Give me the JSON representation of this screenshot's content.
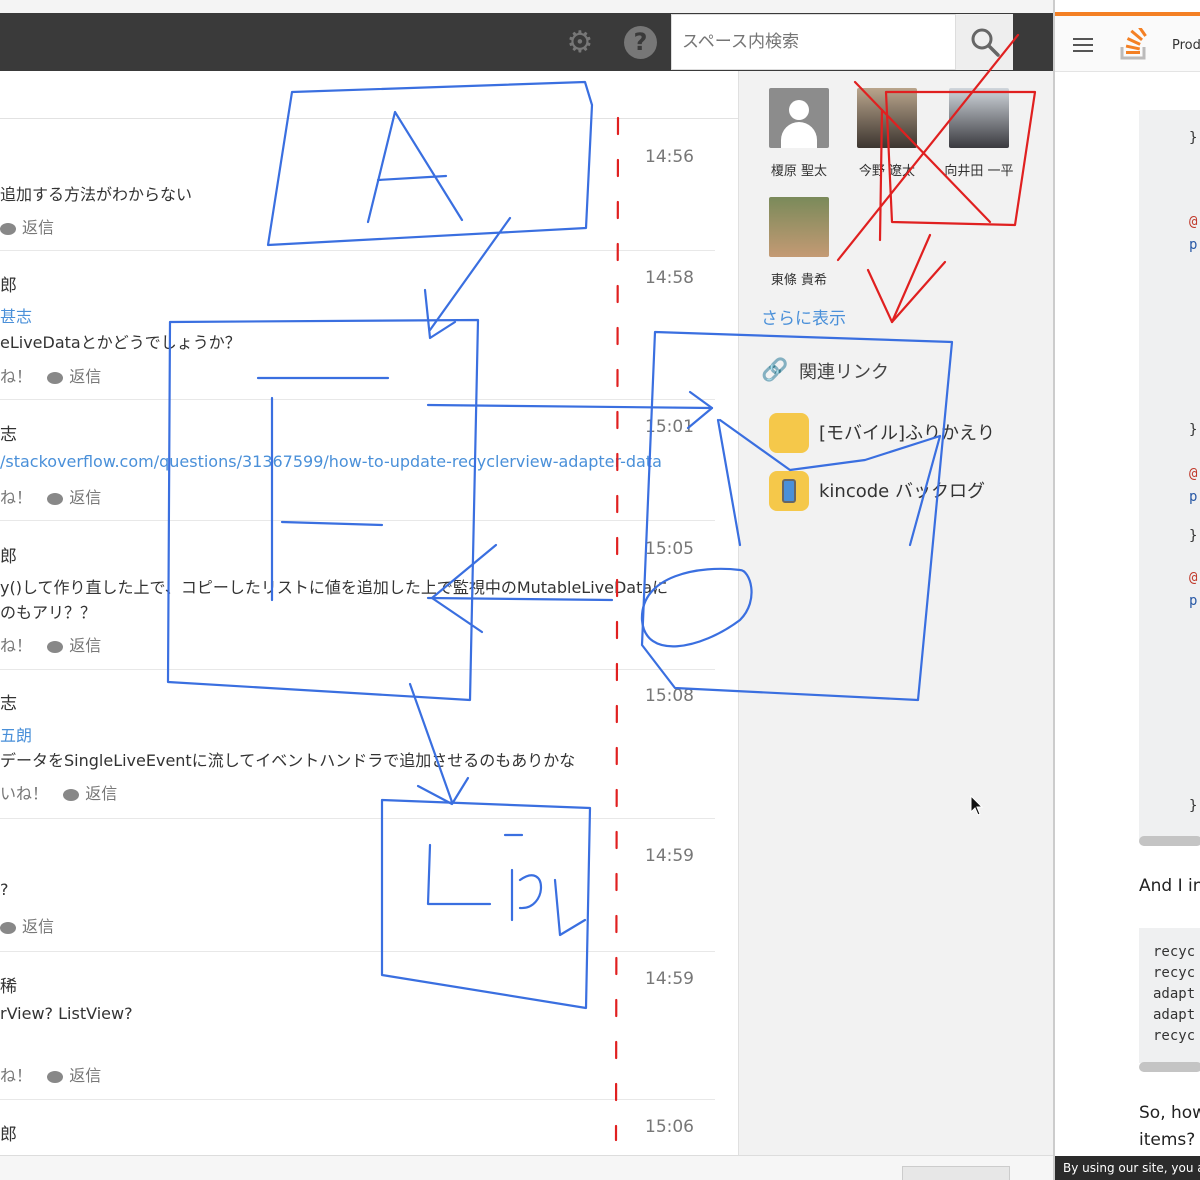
{
  "header": {
    "search_placeholder": "スペース内検索",
    "settings_icon": "gear-icon",
    "help_icon": "help-icon",
    "search_icon": "magnifier-icon"
  },
  "posts": [
    {
      "time": "14:56",
      "body": "追加する方法がわからない",
      "reply": "返信"
    },
    {
      "time": "14:58",
      "author": "郎",
      "mention": "甚志",
      "body": "eLiveDataとかどうでしょうか？",
      "like": "ね！",
      "reply": "返信"
    },
    {
      "time": "15:01",
      "author": "志",
      "link": "/stackoverflow.com/questions/31367599/how-to-update-recyclerview-adapter-data",
      "like": "ね！",
      "reply": "返信"
    },
    {
      "time": "15:05",
      "author": "郎",
      "body": "y()して作り直した上で、コピーしたリストに値を追加した上で監視中のMutableLiveDataに",
      "body2": "のもアリ？？",
      "like": "ね！",
      "reply": "返信"
    },
    {
      "time": "15:08",
      "author": "志",
      "mention": "五朗",
      "body": "データをSingleLiveEventに流してイベントハンドラで追加させるのもありかな",
      "like": "いね！",
      "reply": "返信"
    },
    {
      "time": "14:59",
      "body": "?",
      "reply": "返信"
    },
    {
      "time": "14:59",
      "author": "稀",
      "body": "rView? ListView?",
      "like": "ね！",
      "reply": "返信"
    },
    {
      "time": "15:06",
      "author": "郎"
    }
  ],
  "sidebar": {
    "members": [
      {
        "name": "榎原 聖太"
      },
      {
        "name": "今野 遼太"
      },
      {
        "name": "向井田 一平"
      },
      {
        "name": "東條 貴希"
      }
    ],
    "show_more": "さらに表示",
    "related_title": "関連リンク",
    "related": [
      {
        "label": "[モバイル]ふりかえり"
      },
      {
        "label": "kincode バックログ"
      }
    ]
  },
  "so_panel": {
    "menu_label": "Prod",
    "code1": [
      "}",
      "@",
      "p",
      "}",
      "@",
      "p",
      "}",
      "@",
      "p",
      "}"
    ],
    "and_text": "And I in",
    "code2": [
      "recyc",
      "recyc",
      "adapt",
      "adapt",
      "recyc"
    ],
    "so_text_1": "So, how",
    "so_text_2": "items?",
    "cookie": "By using our site, you a"
  },
  "colors": {
    "accent_blue": "#4a90d9",
    "pen_blue": "#3a6fe0",
    "pen_red": "#e02020",
    "so_orange": "#f48024"
  }
}
